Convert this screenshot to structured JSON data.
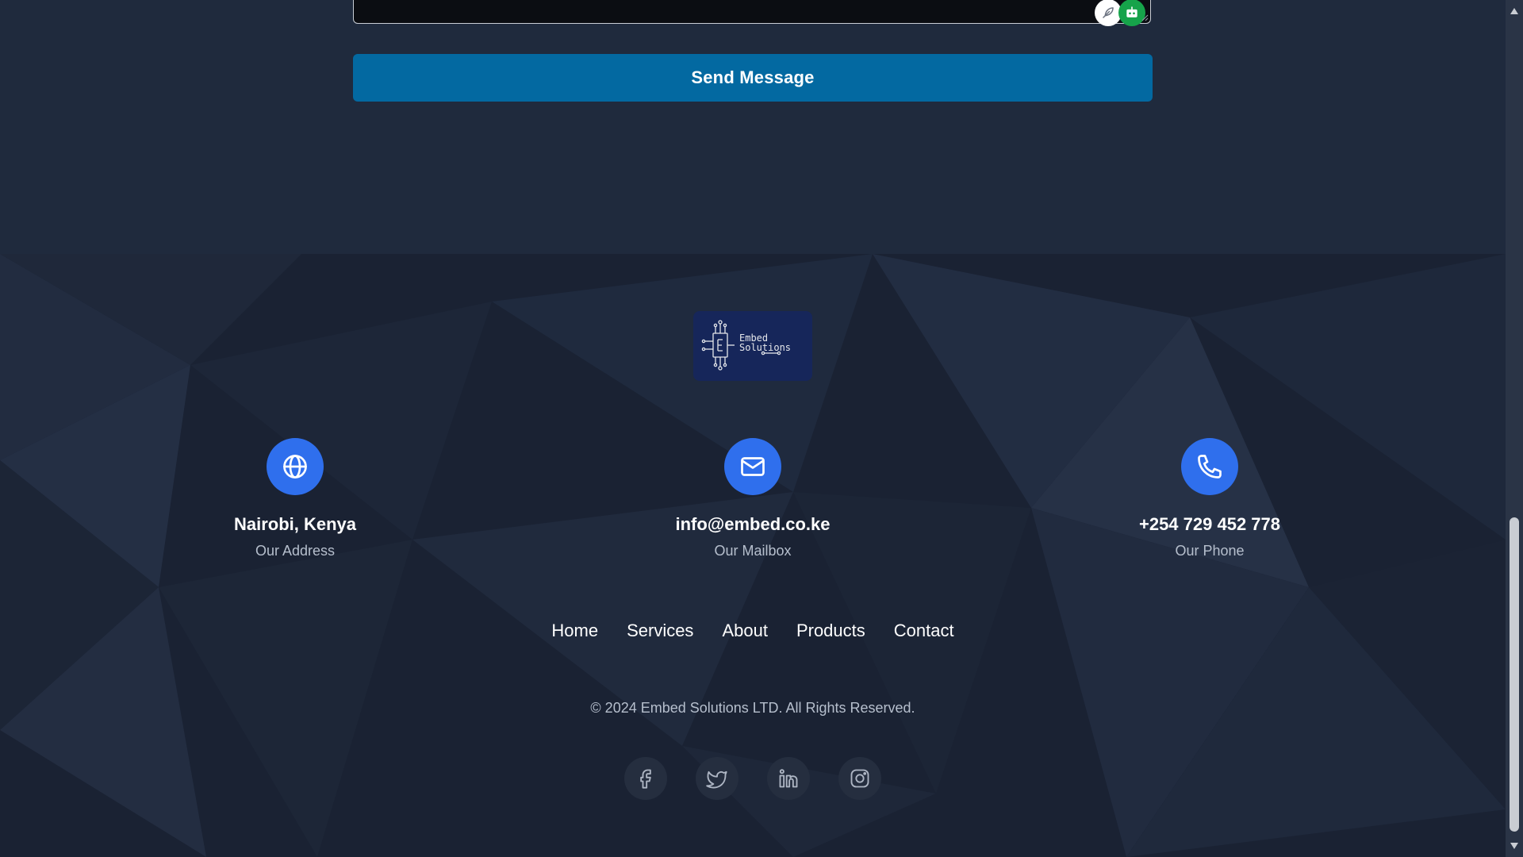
{
  "form": {
    "send_label": "Send Message"
  },
  "logo": {
    "line1": "Embed",
    "line2": "Solutions"
  },
  "contacts": [
    {
      "icon": "globe-icon",
      "value": "Nairobi, Kenya",
      "label": "Our Address"
    },
    {
      "icon": "mail-icon",
      "value": "info@embed.co.ke",
      "label": "Our Mailbox"
    },
    {
      "icon": "phone-icon",
      "value": "+254 729 452 778",
      "label": "Our Phone"
    }
  ],
  "nav": [
    "Home",
    "Services",
    "About",
    "Products",
    "Contact"
  ],
  "copyright": "© 2024 Embed Solutions LTD. All Rights Reserved.",
  "social": [
    "facebook-icon",
    "twitter-icon",
    "linkedin-icon",
    "instagram-icon"
  ],
  "colors": {
    "button": "#0369a1",
    "icon_circle": "#2f6fed",
    "footer_bg": "#1a2233",
    "section_bg": "#1f2a3d",
    "muted_text": "#b6bfcd"
  }
}
